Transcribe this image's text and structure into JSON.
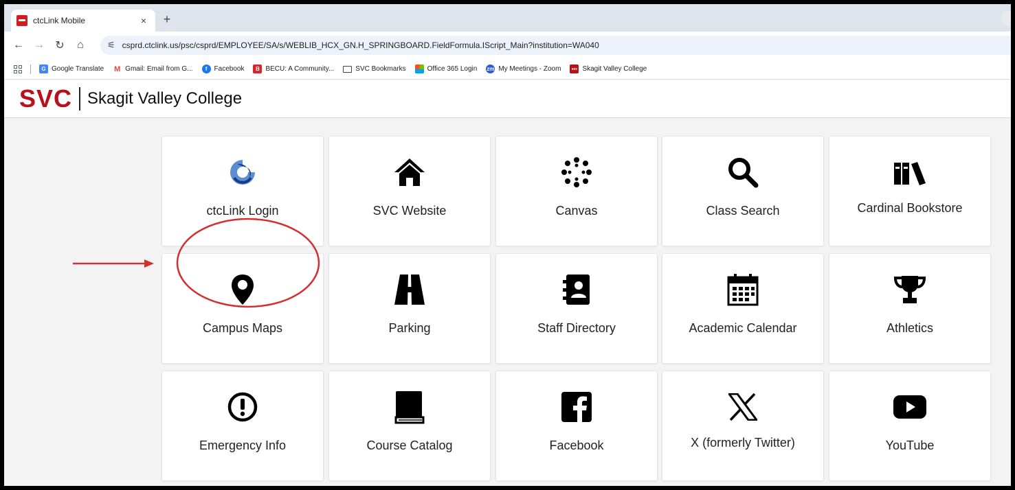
{
  "browser": {
    "tab_title": "ctcLink Mobile",
    "tab_close": "×",
    "new_tab": "+",
    "url": "csprd.ctclink.us/psc/csprd/EMPLOYEE/SA/s/WEBLIB_HCX_GN.H_SPRINGBOARD.FieldFormula.IScript_Main?institution=WA040",
    "bookmarks": [
      {
        "label": "Google Translate",
        "icon": "translate-icon",
        "color": "#4285f4",
        "glyph": "G"
      },
      {
        "label": "Gmail: Email from G...",
        "icon": "gmail-icon",
        "color": "#ea4335",
        "glyph": "M"
      },
      {
        "label": "Facebook",
        "icon": "facebook-icon",
        "color": "#1877f2",
        "glyph": "f"
      },
      {
        "label": "BECU: A Community...",
        "icon": "becu-icon",
        "color": "#d7262e",
        "glyph": "B"
      },
      {
        "label": "SVC Bookmarks",
        "icon": "folder-icon",
        "color": "#ffffff",
        "glyph": ""
      },
      {
        "label": "Office 365 Login",
        "icon": "office-icon",
        "color": "#f25022",
        "glyph": ""
      },
      {
        "label": "My Meetings - Zoom",
        "icon": "zoom-icon",
        "color": "#2d5bd6",
        "glyph": "zm"
      },
      {
        "label": "Skagit Valley College",
        "icon": "svc-icon",
        "color": "#b5121b",
        "glyph": "svc"
      }
    ]
  },
  "site": {
    "logo_abbr": "SVC",
    "logo_name": "Skagit Valley College",
    "brand_color": "#b5121b"
  },
  "tiles": [
    {
      "label": "ctcLink Login",
      "icon": "ctclink-logo-icon"
    },
    {
      "label": "SVC Website",
      "icon": "home-icon"
    },
    {
      "label": "Canvas",
      "icon": "canvas-icon"
    },
    {
      "label": "Class Search",
      "icon": "search-icon"
    },
    {
      "label": "Cardinal Bookstore",
      "icon": "books-icon"
    },
    {
      "label": "Campus Maps",
      "icon": "map-pin-icon"
    },
    {
      "label": "Parking",
      "icon": "road-icon"
    },
    {
      "label": "Staff Directory",
      "icon": "address-book-icon"
    },
    {
      "label": "Academic Calendar",
      "icon": "calendar-icon"
    },
    {
      "label": "Athletics",
      "icon": "trophy-icon"
    },
    {
      "label": "Emergency Info",
      "icon": "exclamation-icon"
    },
    {
      "label": "Course Catalog",
      "icon": "book-icon"
    },
    {
      "label": "Facebook",
      "icon": "facebook-square-icon"
    },
    {
      "label": "X (formerly Twitter)",
      "icon": "x-logo-icon"
    },
    {
      "label": "YouTube",
      "icon": "youtube-icon"
    }
  ],
  "annotation_color": "#d32f2f"
}
